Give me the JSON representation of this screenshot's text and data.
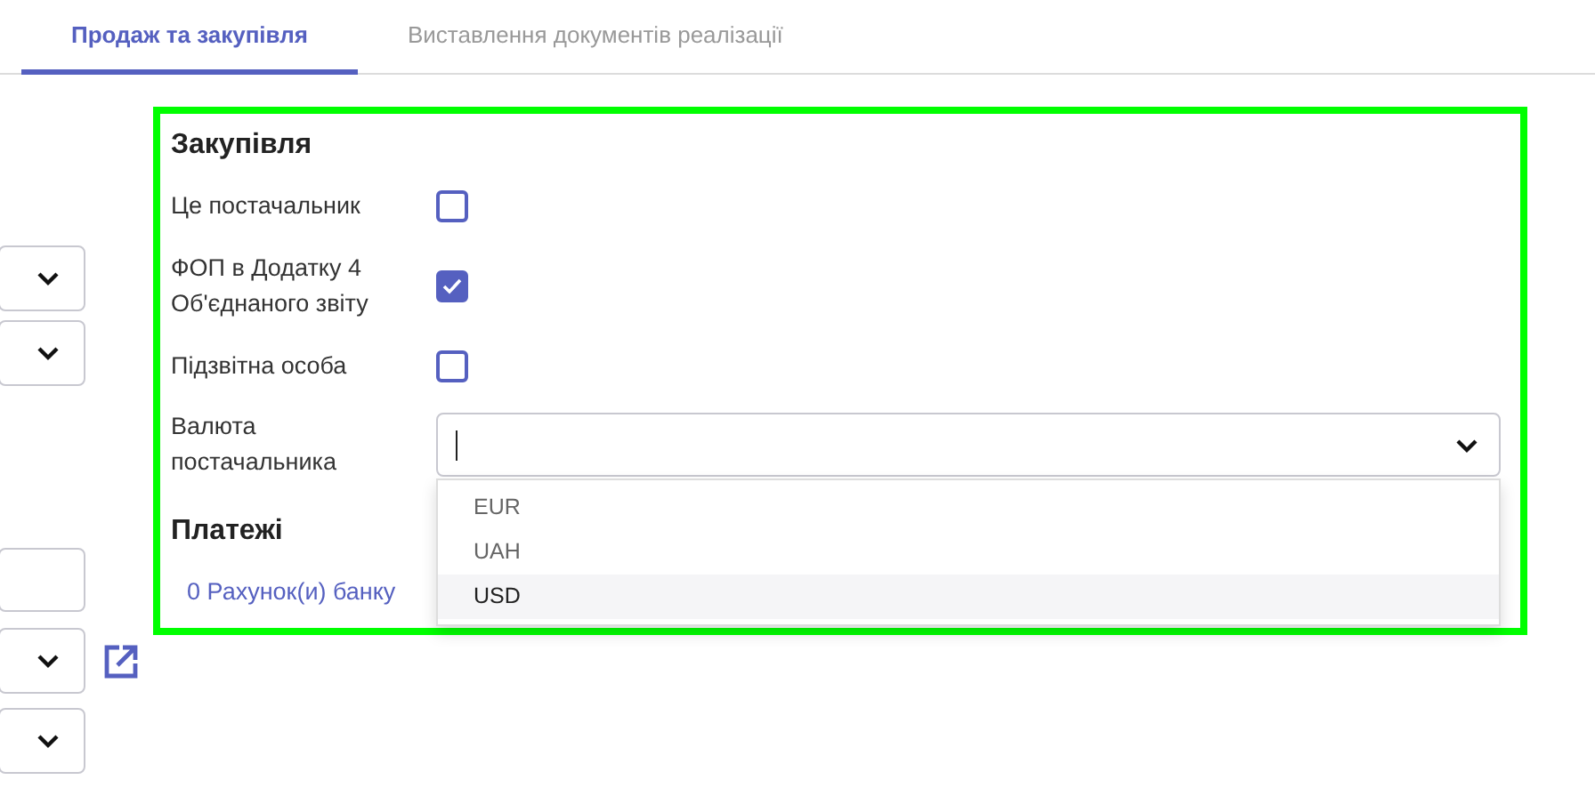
{
  "tabs": [
    {
      "label": "Продаж та закупівля",
      "selected": true
    },
    {
      "label": "Виставлення документів реалізації",
      "selected": false
    }
  ],
  "left_fields": [
    {
      "kind": "select"
    },
    {
      "kind": "select"
    },
    {
      "kind": "input"
    },
    {
      "kind": "select",
      "link": true
    },
    {
      "kind": "select"
    }
  ],
  "purchase": {
    "title": "Закупівля",
    "checkboxes": [
      {
        "label": "Це постачальник",
        "checked": false
      },
      {
        "label": "ФОП в Додатку 4 Об'єднаного звіту",
        "checked": true
      },
      {
        "label": "Підзвітна особа",
        "checked": false
      }
    ],
    "currency": {
      "label": "Валюта постачальника",
      "open": true,
      "options": [
        {
          "label": "EUR",
          "selected": false
        },
        {
          "label": "UAH",
          "selected": false
        },
        {
          "label": "USD",
          "selected": true
        }
      ]
    }
  },
  "payments": {
    "title": "Платежі",
    "link": "0 Рахунок(и) банку"
  }
}
